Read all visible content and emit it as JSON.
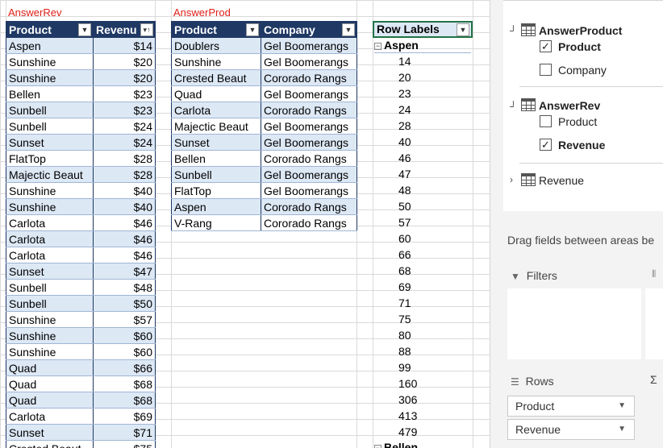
{
  "answer_rev": {
    "title": "AnswerRev",
    "headers": [
      "Product",
      "Revenu"
    ],
    "rows": [
      [
        "Aspen",
        "$14"
      ],
      [
        "Sunshine",
        "$20"
      ],
      [
        "Sunshine",
        "$20"
      ],
      [
        "Bellen",
        "$23"
      ],
      [
        "Sunbell",
        "$23"
      ],
      [
        "Sunbell",
        "$24"
      ],
      [
        "Sunset",
        "$24"
      ],
      [
        "FlatTop",
        "$28"
      ],
      [
        "Majectic Beaut",
        "$28"
      ],
      [
        "Sunshine",
        "$40"
      ],
      [
        "Sunshine",
        "$40"
      ],
      [
        "Carlota",
        "$46"
      ],
      [
        "Carlota",
        "$46"
      ],
      [
        "Carlota",
        "$46"
      ],
      [
        "Sunset",
        "$47"
      ],
      [
        "Sunbell",
        "$48"
      ],
      [
        "Sunbell",
        "$50"
      ],
      [
        "Sunshine",
        "$57"
      ],
      [
        "Sunshine",
        "$60"
      ],
      [
        "Sunshine",
        "$60"
      ],
      [
        "Quad",
        "$66"
      ],
      [
        "Quad",
        "$68"
      ],
      [
        "Quad",
        "$68"
      ],
      [
        "Carlota",
        "$69"
      ],
      [
        "Sunset",
        "$71"
      ],
      [
        "Crested Beaut",
        "$75"
      ]
    ]
  },
  "answer_prod": {
    "title": "AnswerProd",
    "headers": [
      "Product",
      "Company"
    ],
    "rows": [
      [
        "Doublers",
        "Gel Boomerangs"
      ],
      [
        "Sunshine",
        "Gel Boomerangs"
      ],
      [
        "Crested Beaut",
        "Cororado Rangs"
      ],
      [
        "Quad",
        "Gel Boomerangs"
      ],
      [
        "Carlota",
        "Cororado Rangs"
      ],
      [
        "Majectic Beaut",
        "Gel Boomerangs"
      ],
      [
        "Sunset",
        "Gel Boomerangs"
      ],
      [
        "Bellen",
        "Cororado Rangs"
      ],
      [
        "Sunbell",
        "Gel Boomerangs"
      ],
      [
        "FlatTop",
        "Gel Boomerangs"
      ],
      [
        "Aspen",
        "Cororado Rangs"
      ],
      [
        "V-Rang",
        "Cororado Rangs"
      ]
    ]
  },
  "pivot": {
    "header": "Row Labels",
    "group": "Aspen",
    "values": [
      "14",
      "20",
      "23",
      "24",
      "28",
      "40",
      "46",
      "47",
      "48",
      "50",
      "57",
      "60",
      "66",
      "68",
      "69",
      "71",
      "75",
      "80",
      "88",
      "99",
      "160",
      "306",
      "413",
      "479"
    ],
    "next_group": "Bellen"
  },
  "field_pane": {
    "tables": [
      {
        "name": "AnswerProduct",
        "fields": [
          {
            "name": "Product",
            "checked": true
          },
          {
            "name": "Company",
            "checked": false
          }
        ]
      },
      {
        "name": "AnswerRev",
        "fields": [
          {
            "name": "Product",
            "checked": false
          },
          {
            "name": "Revenue",
            "checked": true
          }
        ]
      },
      {
        "name": "Revenue"
      }
    ],
    "drag_hint": "Drag fields between areas be",
    "filters_label": "Filters",
    "rows_label": "Rows",
    "row_fields": [
      "Product",
      "Revenue"
    ],
    "sigma": "Σ"
  }
}
